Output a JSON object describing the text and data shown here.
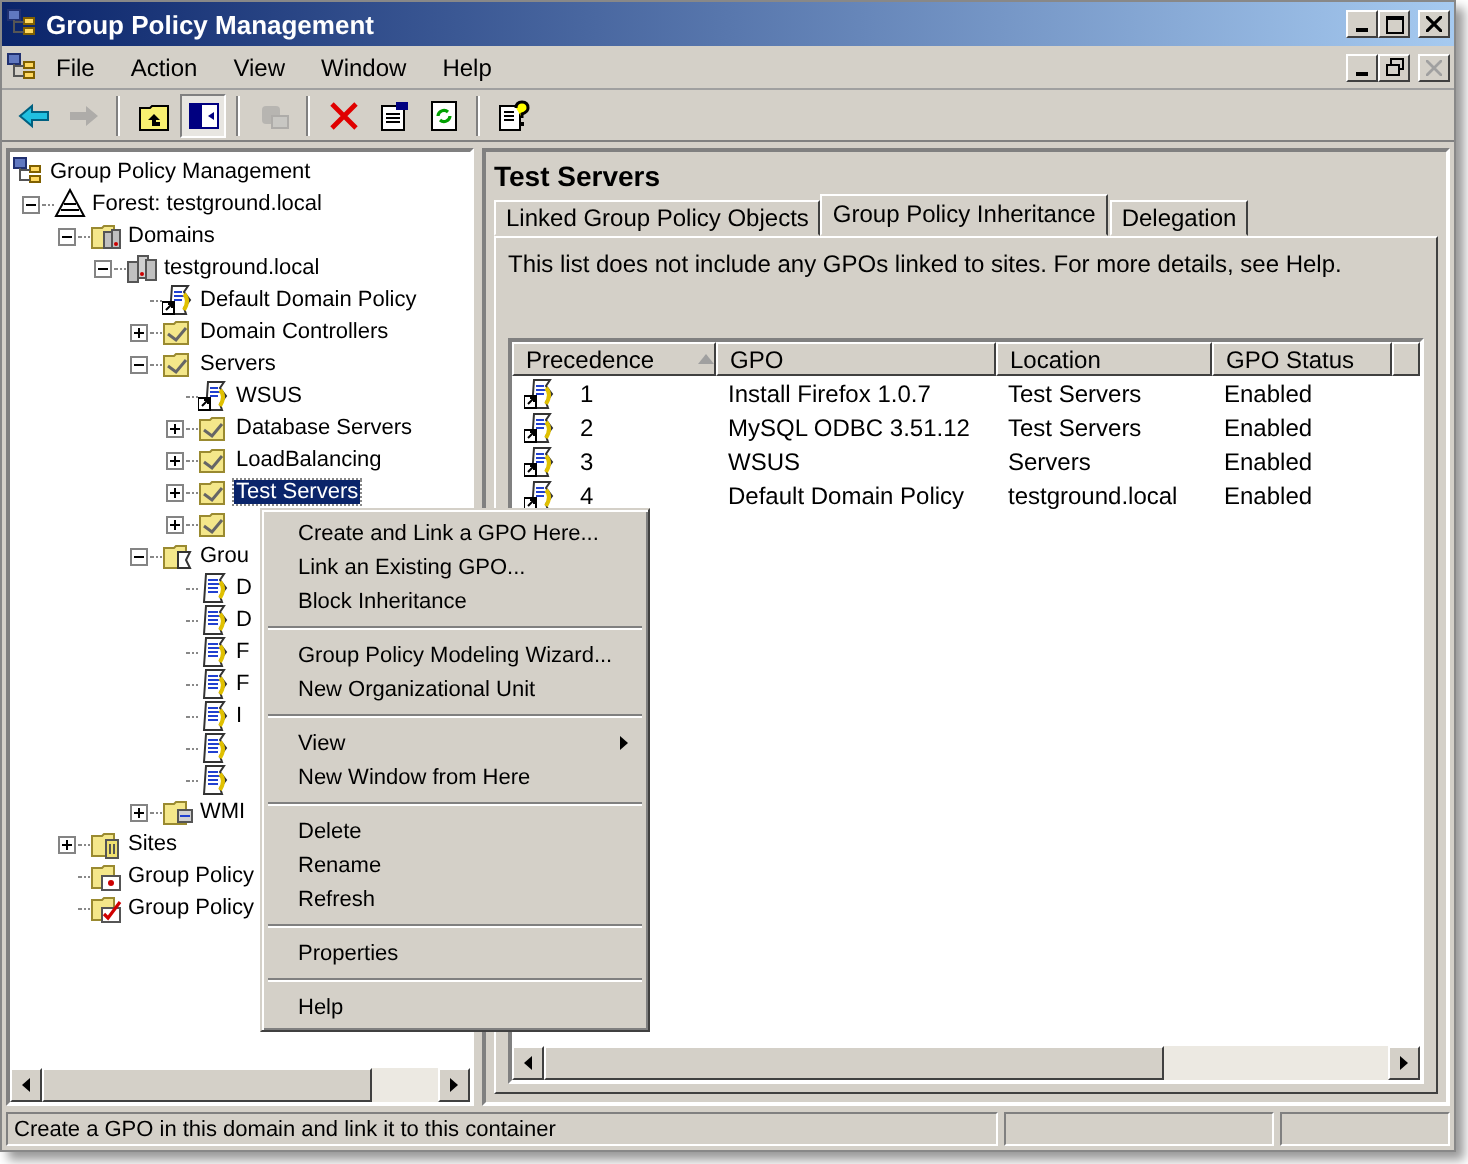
{
  "window": {
    "title": "Group Policy Management"
  },
  "menu_bar": [
    "File",
    "Action",
    "View",
    "Window",
    "Help"
  ],
  "toolbar": [
    {
      "kind": "back",
      "disabled": false
    },
    {
      "kind": "forward",
      "disabled": true
    },
    {
      "kind": "sep"
    },
    {
      "kind": "up",
      "disabled": false
    },
    {
      "kind": "tree",
      "pressed": true
    },
    {
      "kind": "sep"
    },
    {
      "kind": "export",
      "disabled": true
    },
    {
      "kind": "sep"
    },
    {
      "kind": "delete",
      "disabled": false
    },
    {
      "kind": "properties",
      "disabled": false
    },
    {
      "kind": "refresh",
      "disabled": false
    },
    {
      "kind": "sep"
    },
    {
      "kind": "help",
      "disabled": false
    }
  ],
  "tree": [
    {
      "label": "Group Policy Management",
      "kind": "root",
      "selected": false,
      "children": [
        {
          "label": "Forest: testground.local",
          "kind": "forest",
          "expanded": true,
          "selected": false,
          "children": [
            {
              "label": "Domains",
              "kind": "domains",
              "expanded": true,
              "selected": false,
              "children": [
                {
                  "label": "testground.local",
                  "kind": "domain",
                  "expanded": true,
                  "selected": false,
                  "children": [
                    {
                      "label": "Default Domain Policy",
                      "kind": "gpo-link",
                      "selected": false
                    },
                    {
                      "label": "Domain Controllers",
                      "kind": "ou",
                      "expanded": false,
                      "selected": false
                    },
                    {
                      "label": "Servers",
                      "kind": "ou",
                      "expanded": true,
                      "selected": false,
                      "children": [
                        {
                          "label": "WSUS",
                          "kind": "gpo-link",
                          "selected": false
                        },
                        {
                          "label": "Database Servers",
                          "kind": "ou",
                          "expanded": false,
                          "selected": false
                        },
                        {
                          "label": "LoadBalancing",
                          "kind": "ou",
                          "expanded": false,
                          "selected": false
                        },
                        {
                          "label": "Test Servers",
                          "kind": "ou",
                          "expanded": false,
                          "selected": true
                        },
                        {
                          "kind": "ou",
                          "expanded": false,
                          "selected": false
                        }
                      ]
                    },
                    {
                      "label": "Grou",
                      "kind": "gpo-folder",
                      "expanded": true,
                      "selected": false,
                      "children": [
                        {
                          "label": "D",
                          "kind": "gpo",
                          "selected": false
                        },
                        {
                          "label": "D",
                          "kind": "gpo",
                          "selected": false
                        },
                        {
                          "label": "F",
                          "kind": "gpo",
                          "selected": false
                        },
                        {
                          "label": "F",
                          "kind": "gpo",
                          "selected": false
                        },
                        {
                          "label": "I",
                          "kind": "gpo",
                          "selected": false
                        },
                        {
                          "kind": "gpo",
                          "selected": false
                        },
                        {
                          "kind": "gpo",
                          "selected": false
                        }
                      ]
                    },
                    {
                      "label": "WMI",
                      "kind": "wmi",
                      "expanded": false,
                      "selected": false
                    }
                  ]
                }
              ]
            },
            {
              "label": "Sites",
              "kind": "sites",
              "expanded": false,
              "selected": false
            },
            {
              "label": "Group Policy",
              "kind": "modeling",
              "selected": false
            },
            {
              "label": "Group Policy",
              "kind": "results",
              "selected": false
            }
          ]
        }
      ]
    }
  ],
  "context_menu": [
    {
      "label": "Create and Link a GPO Here...",
      "kind": "item",
      "highlighted": false
    },
    {
      "label": "Link an Existing GPO...",
      "kind": "item",
      "highlighted": false
    },
    {
      "label": "Block Inheritance",
      "kind": "item",
      "highlighted": false
    },
    {
      "kind": "sep"
    },
    {
      "label": "Group Policy Modeling Wizard...",
      "kind": "item",
      "highlighted": false
    },
    {
      "label": "New Organizational Unit",
      "kind": "item",
      "highlighted": false
    },
    {
      "kind": "sep"
    },
    {
      "label": "View",
      "kind": "submenu",
      "highlighted": false
    },
    {
      "label": "New Window from Here",
      "kind": "item",
      "highlighted": false
    },
    {
      "kind": "sep"
    },
    {
      "label": "Delete",
      "kind": "item",
      "highlighted": false
    },
    {
      "label": "Rename",
      "kind": "item",
      "highlighted": false
    },
    {
      "label": "Refresh",
      "kind": "item",
      "highlighted": false
    },
    {
      "kind": "sep"
    },
    {
      "label": "Properties",
      "kind": "item",
      "highlighted": false
    },
    {
      "kind": "sep"
    },
    {
      "label": "Help",
      "kind": "item",
      "highlighted": false
    }
  ],
  "details": {
    "title": "Test Servers",
    "tabs": [
      {
        "label": "Linked Group Policy Objects",
        "selected": false
      },
      {
        "label": "Group Policy Inheritance",
        "selected": true
      },
      {
        "label": "Delegation",
        "selected": false
      }
    ],
    "note": "This list does not include any GPOs linked to sites. For more details, see Help.",
    "table": {
      "columns": [
        "Precedence",
        "GPO",
        "Location",
        "GPO Status"
      ],
      "rows": [
        [
          "1",
          "Install Firefox 1.0.7",
          "Test Servers",
          "Enabled"
        ],
        [
          "2",
          "MySQL ODBC 3.51.12",
          "Test Servers",
          "Enabled"
        ],
        [
          "3",
          "WSUS",
          "Servers",
          "Enabled"
        ],
        [
          "4",
          "Default Domain Policy",
          "testground.local",
          "Enabled"
        ]
      ]
    }
  },
  "status_bar": [
    "Create a GPO in this domain and link it to this container"
  ]
}
